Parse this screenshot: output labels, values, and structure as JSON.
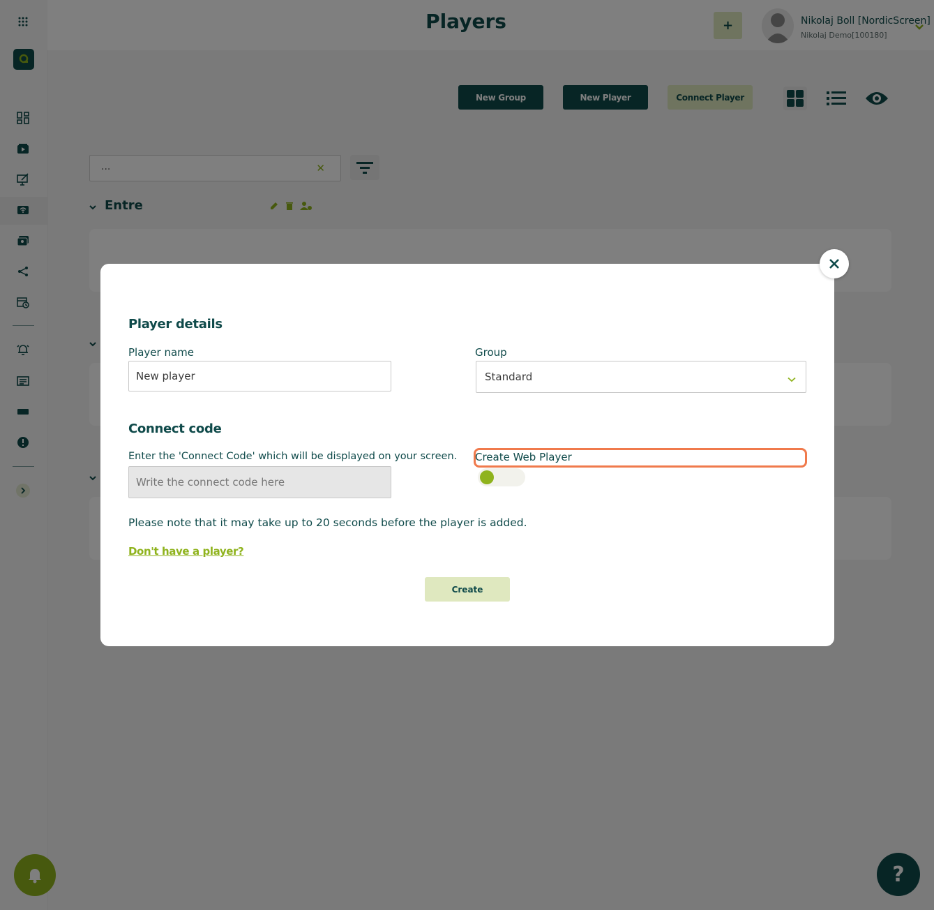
{
  "header": {
    "title": "Players",
    "add_label": "+",
    "user_name": "Nikolaj Boll [NordicScreen]",
    "user_account": "Nikolaj Demo[100180]"
  },
  "sidebar": {
    "items": [
      {
        "icon": "apps-grid-icon"
      },
      {
        "icon": "logo-icon"
      },
      {
        "icon": "dashboard-icon"
      },
      {
        "icon": "media-icon"
      },
      {
        "icon": "content-edit-icon"
      },
      {
        "icon": "players-icon"
      },
      {
        "icon": "playlist-icon"
      },
      {
        "icon": "share-icon"
      },
      {
        "icon": "schedule-icon"
      },
      {
        "icon": "alarm-icon"
      },
      {
        "icon": "news-icon"
      },
      {
        "icon": "ticker-icon"
      },
      {
        "icon": "alert-icon"
      },
      {
        "icon": "expand-icon"
      }
    ]
  },
  "toolbar": {
    "new_group": "New Group",
    "new_player": "New Player",
    "connect_player": "Connect Player"
  },
  "search": {
    "value": "..."
  },
  "groups": [
    {
      "name": "Entre"
    }
  ],
  "modal": {
    "player_details_heading": "Player details",
    "player_name_label": "Player name",
    "player_name_value": "New player",
    "group_label": "Group",
    "group_value": "Standard",
    "connect_code_heading": "Connect code",
    "connect_code_instruction": "Enter the 'Connect Code' which will be displayed on your screen.",
    "connect_code_placeholder": "Write the connect code here",
    "web_player_label": "Create Web Player",
    "web_player_enabled": false,
    "note": "Please note that it may take up to 20 seconds before the player is added.",
    "no_player_link": "Don't have a player?",
    "create_button": "Create"
  },
  "help": {
    "label": "?"
  },
  "colors": {
    "primary_dark": "#0f4a4a",
    "accent_green": "#8fb31d",
    "light_green": "#dfe8bf",
    "highlight": "#f07a4c"
  }
}
